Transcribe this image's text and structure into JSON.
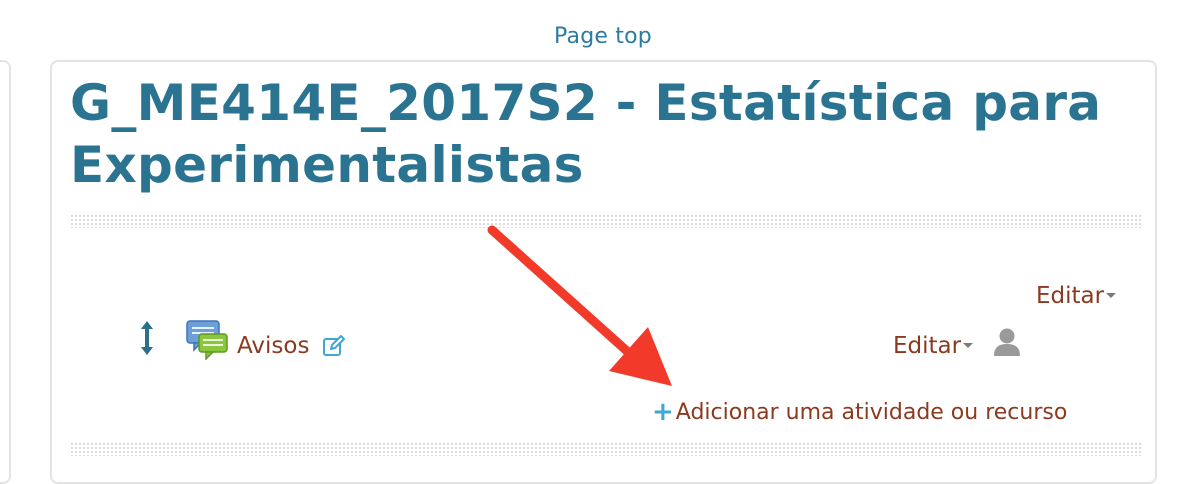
{
  "header": {
    "page_top_label": "Page top"
  },
  "course": {
    "title": "G_ME414E_2017S2 - Estatística para Experimentalistas"
  },
  "section": {
    "edit_menu_label": "Editar",
    "activity": {
      "name": "Avisos",
      "edit_menu_label": "Editar"
    },
    "add_activity_label": "Adicionar uma atividade ou recurso"
  },
  "icons": {
    "move": "move-icon",
    "forum": "forum-icon",
    "edit_title": "pencil-edit-icon",
    "user": "user-icon",
    "plus": "plus-icon",
    "caret": "caret-down-icon",
    "annotation_arrow": "red-arrow-annotation"
  },
  "colors": {
    "link_blue": "#2d7ba2",
    "title_teal": "#2b7491",
    "activity_red": "#8b3a1f",
    "plus_blue": "#3fa6d6",
    "arrow_red": "#f23a2a"
  }
}
